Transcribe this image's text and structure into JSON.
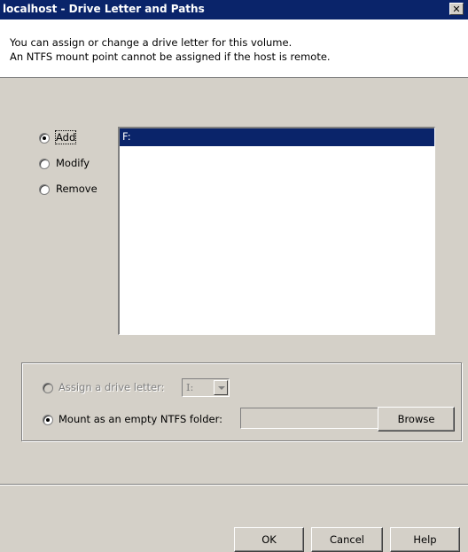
{
  "window": {
    "title": "localhost - Drive Letter and Paths",
    "close_symbol": "✕"
  },
  "header": {
    "line1": "You can assign or change a drive letter for this volume.",
    "line2": "An NTFS mount point cannot be assigned if the host is remote."
  },
  "actions": {
    "selected": "Add",
    "add_label": "Add",
    "modify_label": "Modify",
    "remove_label": "Remove"
  },
  "paths_list": {
    "items": [
      "F:"
    ],
    "selected_index": 0
  },
  "assign_group": {
    "assign_letter_label": "Assign a drive letter:",
    "drive_letter_value": "I:",
    "mount_folder_label": "Mount as an empty NTFS folder:",
    "mount_folder_value": "",
    "browse_label": "Browse",
    "selected": "mount"
  },
  "footer": {
    "ok_label": "OK",
    "cancel_label": "Cancel",
    "help_label": "Help"
  },
  "colors": {
    "titlebar": "#0a246a",
    "dialog_bg": "#d4d0c8",
    "selection": "#0a246a"
  }
}
